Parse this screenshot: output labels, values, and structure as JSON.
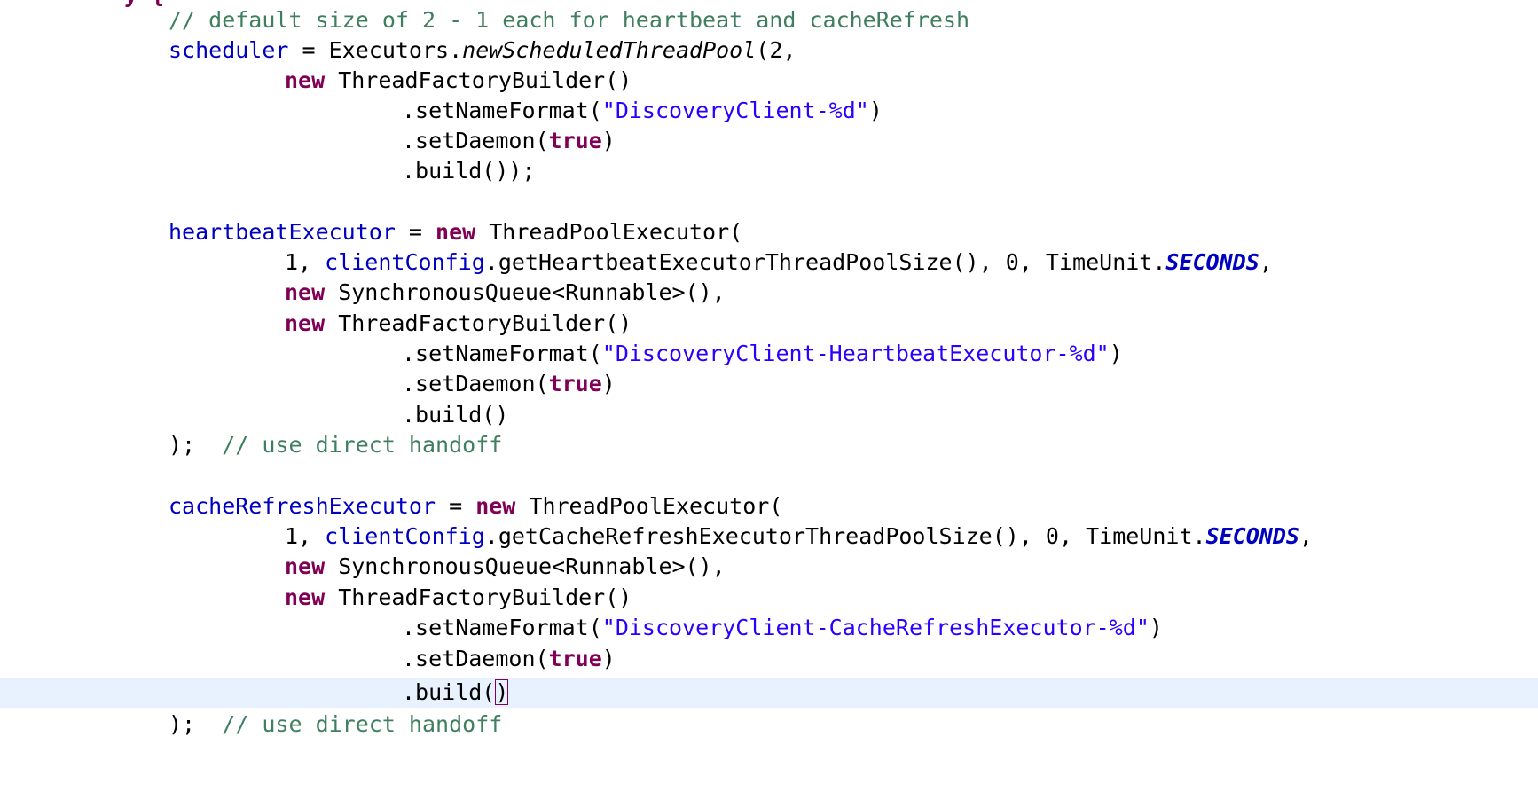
{
  "editor": {
    "partial_top_line": "y {",
    "line1": {
      "comment": "// default size of 2 - 1 each for heartbeat and cacheRefresh"
    },
    "line2": {
      "field": "scheduler",
      "op": " = Executors.",
      "method": "newScheduledThreadPool",
      "rest": "(2,"
    },
    "line3": {
      "kw": "new",
      "rest": " ThreadFactoryBuilder()"
    },
    "line4": {
      "pre": ".setNameFormat(",
      "str": "\"DiscoveryClient-%d\"",
      "post": ")"
    },
    "line5": {
      "pre": ".setDaemon(",
      "kw": "true",
      "post": ")"
    },
    "line6": {
      "text": ".build());"
    },
    "line8": {
      "field": "heartbeatExecutor",
      "op": " = ",
      "kw": "new",
      "rest": " ThreadPoolExecutor("
    },
    "line9": {
      "pre": "1, ",
      "field": "clientConfig",
      "mid": ".getHeartbeatExecutorThreadPoolSize(), 0, TimeUnit.",
      "const": "SECONDS",
      "post": ","
    },
    "line10": {
      "kw": "new",
      "rest": " SynchronousQueue<Runnable>(),"
    },
    "line11": {
      "kw": "new",
      "rest": " ThreadFactoryBuilder()"
    },
    "line12": {
      "pre": ".setNameFormat(",
      "str": "\"DiscoveryClient-HeartbeatExecutor-%d\"",
      "post": ")"
    },
    "line13": {
      "pre": ".setDaemon(",
      "kw": "true",
      "post": ")"
    },
    "line14": {
      "text": ".build()"
    },
    "line15": {
      "pre": ");  ",
      "comment": "// use direct handoff"
    },
    "line17": {
      "field": "cacheRefreshExecutor",
      "op": " = ",
      "kw": "new",
      "rest": " ThreadPoolExecutor("
    },
    "line18": {
      "pre": "1, ",
      "field": "clientConfig",
      "mid": ".getCacheRefreshExecutorThreadPoolSize(), 0, TimeUnit.",
      "const": "SECONDS",
      "post": ","
    },
    "line19": {
      "kw": "new",
      "rest": " SynchronousQueue<Runnable>(),"
    },
    "line20": {
      "kw": "new",
      "rest": " ThreadFactoryBuilder()"
    },
    "line21": {
      "pre": ".setNameFormat(",
      "str": "\"DiscoveryClient-CacheRefreshExecutor-%d\"",
      "post": ")"
    },
    "line22": {
      "pre": ".setDaemon(",
      "kw": "true",
      "post": ")"
    },
    "line23": {
      "pre": ".build(",
      "bracket": ")"
    },
    "line24": {
      "pre": ");  ",
      "comment": "// use direct handoff"
    }
  },
  "colors": {
    "keyword": "#7f0055",
    "field": "#0000c0",
    "string": "#2a00ff",
    "comment": "#3f7f5f",
    "current_line": "#e8f2fe"
  }
}
